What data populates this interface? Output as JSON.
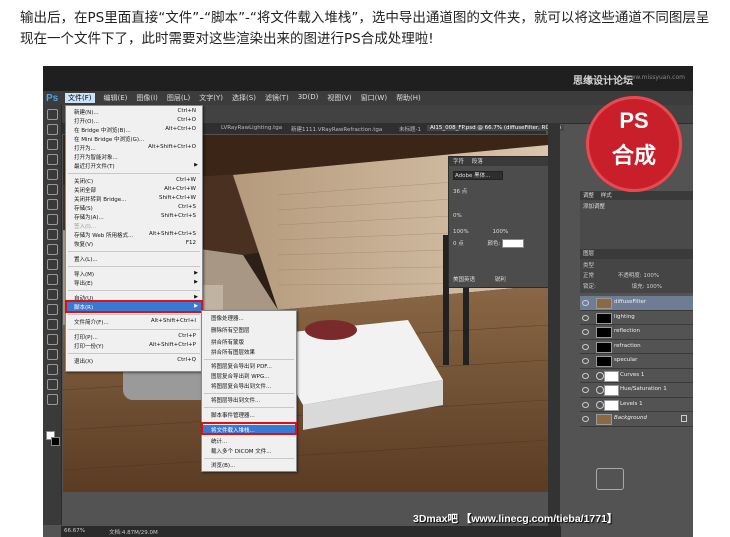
{
  "caption": "输出后，在PS里面直接“文件”-“脚本”-“将文件载入堆栈”，选中导出通道图的文件夹，就可以将这些通道不同图层呈现在一个文件下了，此时需要对这些渲染出来的图进行PS合成处理啦!",
  "watermark_top": "思缘设计论坛",
  "watermark_url": "www.missyuan.com",
  "ps_logo": "Ps",
  "menubar": [
    "文件(F)",
    "编辑(E)",
    "图像(I)",
    "图层(L)",
    "文字(Y)",
    "选择(S)",
    "滤镜(T)",
    "3D(D)",
    "视图(V)",
    "窗口(W)",
    "帮助(H)"
  ],
  "tabs": [
    "LVRayRawLighting.tga",
    "新建1111.VRayRawRefraction.tga",
    "未标题-1",
    "AI15_008_FP.psd @ 66.7% (diffuseFilter, RGB/8)"
  ],
  "status": {
    "zoom": "66.67%",
    "doc": "文档:4.87M/29.0M"
  },
  "file_menu": [
    {
      "label": "新建(N)...",
      "shortcut": "Ctrl+N"
    },
    {
      "label": "打开(O)...",
      "shortcut": "Ctrl+O"
    },
    {
      "label": "在 Bridge 中浏览(B)...",
      "shortcut": "Alt+Ctrl+O"
    },
    {
      "label": "在 Mini Bridge 中浏览(G)...",
      "shortcut": ""
    },
    {
      "label": "打开为...",
      "shortcut": "Alt+Shift+Ctrl+O"
    },
    {
      "label": "打开为智能对象...",
      "shortcut": ""
    },
    {
      "label": "最近打开文件(T)",
      "shortcut": ""
    },
    {
      "label": "关闭(C)",
      "shortcut": "Ctrl+W"
    },
    {
      "label": "关闭全部",
      "shortcut": "Alt+Ctrl+W"
    },
    {
      "label": "关闭并转到 Bridge...",
      "shortcut": "Shift+Ctrl+W"
    },
    {
      "label": "存储(S)",
      "shortcut": "Ctrl+S"
    },
    {
      "label": "存储为(A)...",
      "shortcut": "Shift+Ctrl+S"
    },
    {
      "label": "签入(I)...",
      "shortcut": ""
    },
    {
      "label": "存储为 Web 所用格式...",
      "shortcut": "Alt+Shift+Ctrl+S"
    },
    {
      "label": "恢复(V)",
      "shortcut": "F12"
    },
    {
      "label": "置入(L)...",
      "shortcut": ""
    },
    {
      "label": "导入(M)",
      "shortcut": ""
    },
    {
      "label": "导出(E)",
      "shortcut": ""
    },
    {
      "label": "自动(U)",
      "shortcut": ""
    },
    {
      "label": "脚本(R)",
      "shortcut": ""
    },
    {
      "label": "文件简介(F)...",
      "shortcut": "Alt+Shift+Ctrl+I"
    },
    {
      "label": "打印(P)...",
      "shortcut": "Ctrl+P"
    },
    {
      "label": "打印一份(Y)",
      "shortcut": "Alt+Shift+Ctrl+P"
    },
    {
      "label": "退出(X)",
      "shortcut": "Ctrl+Q"
    }
  ],
  "script_menu": [
    "图像处理器...",
    "删除所有空图层",
    "拼合所有蒙版",
    "拼合所有图层效果",
    "将图层复合导出到 PDF...",
    "图层复合导出到 WPG...",
    "将图层复合导出到文件...",
    "将图层导出到文件...",
    "脚本事件管理器...",
    "将文件载入堆栈...",
    "统计...",
    "载入多个 DICOM 文件...",
    "浏览(B)..."
  ],
  "character_panel": {
    "tabs": [
      "字符",
      "段落"
    ],
    "font": "Adobe 黑体...",
    "size": "36 点",
    "tracking": "0%",
    "scale_v": "100%",
    "scale_h": "100%",
    "baseline": "0 点",
    "color_label": "颜色:",
    "language": "美国英语",
    "aa": "锐利"
  },
  "adjust_panel": {
    "tabs": [
      "调整",
      "样式"
    ],
    "label": "添加调整"
  },
  "layers": {
    "header": "图层",
    "kind": "类型",
    "blend": "正常",
    "opacity_label": "不透明度:",
    "opacity": "100%",
    "lock_label": "锁定:",
    "fill_label": "填充:",
    "fill": "100%",
    "items": [
      {
        "name": "diffuseFilter",
        "thumb": "photo",
        "adjust": false,
        "selected": true
      },
      {
        "name": "lighting",
        "thumb": "dark",
        "adjust": false,
        "selected": false
      },
      {
        "name": "reflection",
        "thumb": "dark",
        "adjust": false,
        "selected": false
      },
      {
        "name": "refraction",
        "thumb": "dark",
        "adjust": false,
        "selected": false
      },
      {
        "name": "specular",
        "thumb": "dark",
        "adjust": false,
        "selected": false
      },
      {
        "name": "Curves 1",
        "thumb": "white",
        "adjust": true,
        "selected": false
      },
      {
        "name": "Hue/Saturation 1",
        "thumb": "white",
        "adjust": true,
        "selected": false
      },
      {
        "name": "Levels 1",
        "thumb": "white",
        "adjust": true,
        "selected": false
      },
      {
        "name": "Background",
        "thumb": "photo",
        "adjust": false,
        "selected": false
      }
    ]
  },
  "badge": {
    "line1": "PS",
    "line2": "合成"
  },
  "bottom_banner": "3Dmax吧 【www.linecg.com/tieba/1771】",
  "colors": {
    "badge": "#c91f2a",
    "menu_highlight": "#3a79d3",
    "red_box": "#e01010"
  }
}
